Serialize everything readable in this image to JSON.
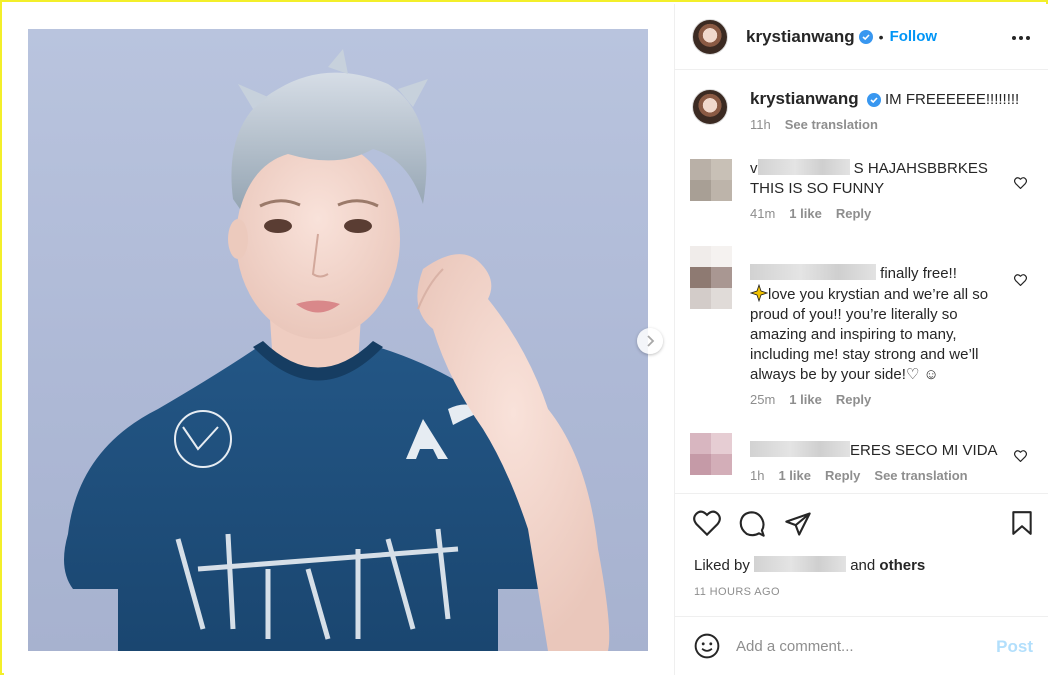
{
  "post": {
    "username": "krystianwang",
    "follow_label": "Follow",
    "dot": "•",
    "caption": "IM FREEEEEE!!!!!!!!",
    "caption_time": "11h",
    "see_translation": "See translation"
  },
  "comments": [
    {
      "prefix": "v",
      "text": "S HAJAHSBBRKES THIS IS SO FUNNY",
      "time": "41m",
      "likes": "1 like",
      "reply": "Reply"
    },
    {
      "text": "finally free!!",
      "text2": "love you krystian and we’re all so proud of you!! you’re literally so amazing and inspiring to many, including me! stay strong and we’ll always be by your side!♡ ☺",
      "time": "25m",
      "likes": "1 like",
      "reply": "Reply"
    },
    {
      "text": "ERES SECO MI VIDA",
      "time": "1h",
      "likes": "1 like",
      "reply": "Reply",
      "see_translation": "See translation"
    }
  ],
  "liked_by": {
    "prefix": "Liked by",
    "and": "and",
    "others": "others"
  },
  "timestamp": "11 HOURS AGO",
  "add_comment": {
    "placeholder": "Add a comment...",
    "post_label": "Post"
  },
  "colors": {
    "accent": "#0095f6",
    "post_disabled": "#b2dffc",
    "verified": "#3897f0",
    "shirt": "#1f4f7d"
  },
  "icons": [
    "verified-icon",
    "more-icon",
    "next-arrow-icon",
    "heart-icon",
    "comment-icon",
    "share-icon",
    "bookmark-icon",
    "emoji-icon",
    "sparkles-icon"
  ]
}
